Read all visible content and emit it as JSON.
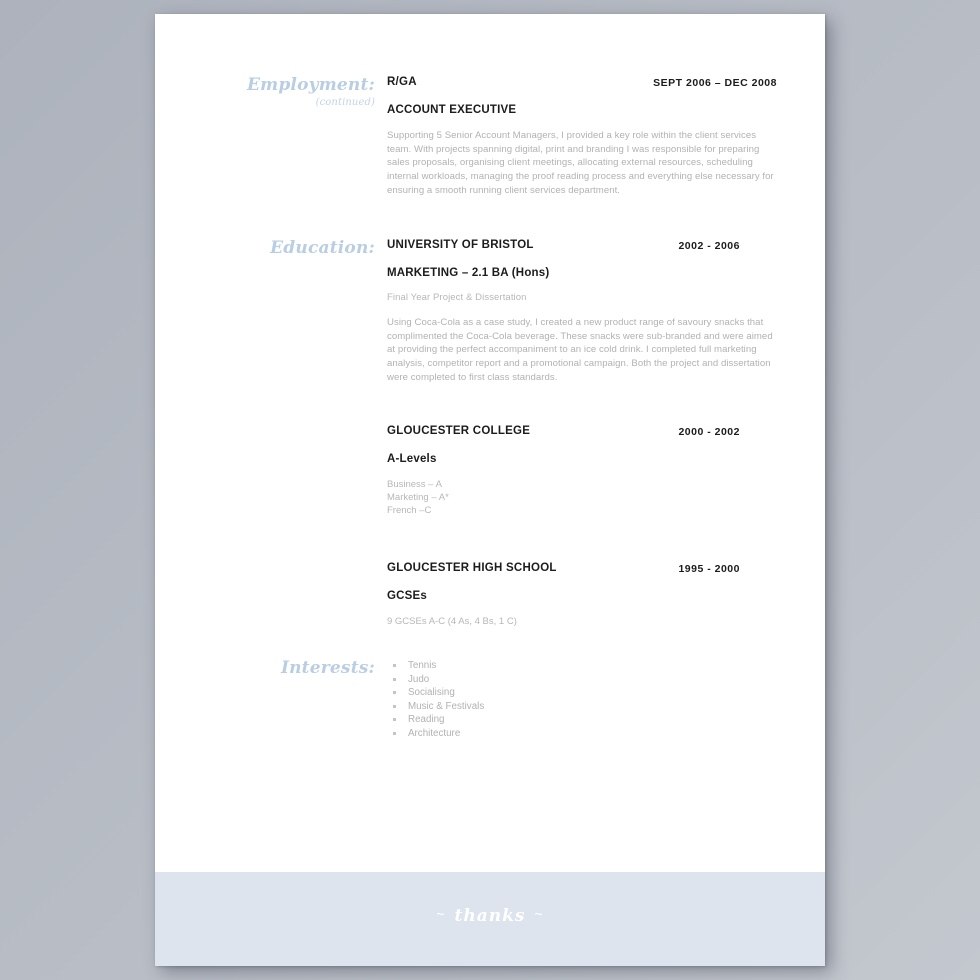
{
  "document": {
    "type": "cv-resume-page",
    "page_background": "#ffffff",
    "canvas_background": "#b4b9c2",
    "accent_color": "#b9cee2",
    "heading_color": "#1c1c1c",
    "body_color": "#b2b2b2"
  },
  "sections": {
    "employment": {
      "heading": "Employment:",
      "subheading": "(continued)",
      "entry": {
        "organisation": "R/GA",
        "dates": "SEPT 2006 – DEC 2008",
        "role": "ACCOUNT EXECUTIVE",
        "description": "Supporting 5 Senior Account Managers, I provided a key role within the client services team.  With projects spanning digital, print and branding I was responsible for preparing sales proposals, organising client meetings, allocating external resources, scheduling internal workloads, managing the proof reading process and everything else necessary for ensuring a smooth running client services department."
      }
    },
    "education": {
      "heading": "Education:",
      "entries": [
        {
          "organisation": "UNIVERSITY OF BRISTOL",
          "dates": "2002 - 2006",
          "qualification": "MARKETING – 2.1 BA (Hons)",
          "note": "Final Year Project & Dissertation",
          "description": "Using Coca-Cola as a case study, I created a new product range of savoury snacks that complimented the Coca-Cola beverage.  These snacks were sub-branded and were aimed at providing the perfect accompaniment to an ice cold drink.  I completed full marketing analysis, competitor report and a promotional campaign. Both the project and dissertation were completed to first class standards."
        },
        {
          "organisation": "GLOUCESTER COLLEGE",
          "dates": "2000 - 2002",
          "qualification": "A-Levels",
          "grades": [
            "Business – A",
            "Marketing – A*",
            "French –C"
          ]
        },
        {
          "organisation": "GLOUCESTER HIGH SCHOOL",
          "dates": "1995 - 2000",
          "qualification": "GCSEs",
          "grades": [
            "9 GCSEs A-C (4 As, 4 Bs, 1 C)"
          ]
        }
      ]
    },
    "interests": {
      "heading": "Interests:",
      "items": [
        "Tennis",
        "Judo",
        "Socialising",
        "Music & Festivals",
        "Reading",
        "Architecture"
      ]
    }
  },
  "footer": {
    "text": "thanks",
    "ornament_left": "~",
    "ornament_right": "~",
    "background": "#dee4ed"
  }
}
